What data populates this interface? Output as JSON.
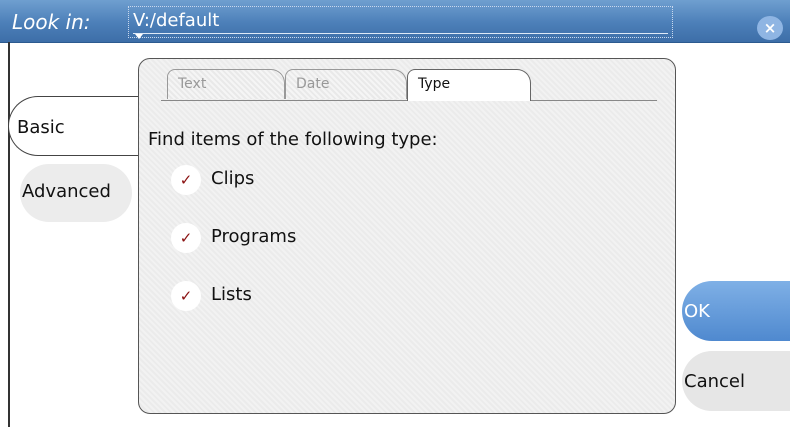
{
  "titlebar": {
    "label": "Look in:",
    "path": "V:/default",
    "close_glyph": "×",
    "close_icon": "close-icon"
  },
  "side_tabs": [
    {
      "label": "Basic",
      "selected": true
    },
    {
      "label": "Advanced",
      "selected": false
    }
  ],
  "tabs": [
    {
      "label": "Text",
      "selected": false
    },
    {
      "label": "Date",
      "selected": false
    },
    {
      "label": "Type",
      "selected": true
    }
  ],
  "type_panel": {
    "heading": "Find items of the following type:",
    "check_glyph": "✓",
    "options": [
      {
        "label": "Clips",
        "checked": true
      },
      {
        "label": "Programs",
        "checked": true
      },
      {
        "label": "Lists",
        "checked": true
      }
    ]
  },
  "buttons": {
    "ok": "OK",
    "cancel": "Cancel"
  },
  "colors": {
    "titlebar": "#4c7fb8",
    "ok_button": "#4f89cf",
    "check": "#8a1010"
  }
}
